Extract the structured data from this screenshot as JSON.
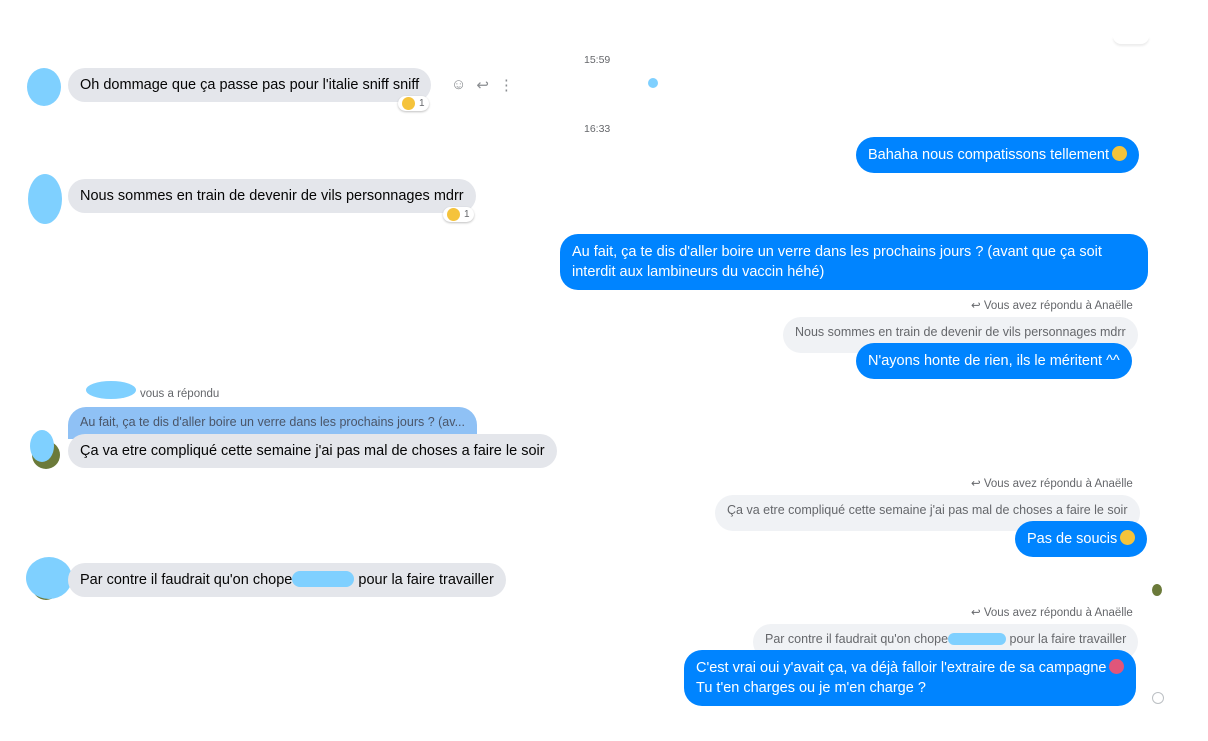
{
  "timestamps": [
    "15:59",
    "16:33"
  ],
  "messages": {
    "m1": "Oh dommage que ça passe pas pour l'italie sniff sniff",
    "m2": "Bahaha nous compatissons tellement",
    "m3": "Nous sommes en train de devenir de vils personnages mdrr",
    "m4": "Au fait, ça te dis d'aller boire un verre dans les prochains jours ? (avant que ça soit interdit aux lambineurs du vaccin héhé)",
    "m5_quote": "Nous sommes en train de devenir de vils personnages mdrr",
    "m5": "N'ayons honte de rien, ils le méritent ^^",
    "m6_replied": "vous a répondu",
    "m6_quote": "Au fait, ça te dis d'aller boire un verre dans les prochains jours ? (av...",
    "m6": "Ça va etre compliqué cette semaine j'ai pas mal de choses a faire le soir",
    "m7_quote": "Ça va etre compliqué cette semaine j'ai pas mal de choses a faire le soir",
    "m7": "Pas de soucis",
    "m8_a": "Par contre il faudrait qu'on chope",
    "m8_b": "pour la faire travailler",
    "m9_quote_a": "Par contre il faudrait qu'on chope",
    "m9_quote_b": "pour la faire travailler",
    "m9_line1": "C'est vrai oui y'avait ça, va déjà falloir l'extraire de sa campagne",
    "m9_line2": "Tu t'en charges ou je m'en charge ?"
  },
  "replied_to": "Vous avez répondu à Anaëlle",
  "reaction_count": "1",
  "icons": [
    "smiley-icon",
    "reply-icon",
    "more-icon",
    "laughing-emoji",
    "upside-down-emoji",
    "dizzy-emoji",
    "pig-emoji",
    "reply-arrow-icon"
  ],
  "colors": {
    "outgoing": "#0084ff",
    "incoming": "#e4e6eb",
    "quote": "#f0f2f5",
    "redaction": "#7fd0ff"
  }
}
